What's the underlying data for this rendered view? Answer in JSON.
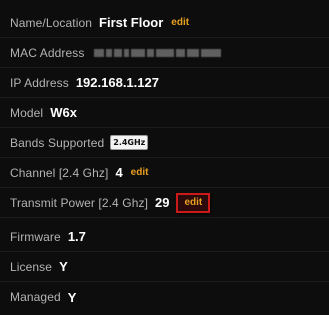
{
  "rows": {
    "name": {
      "label": "Name/Location",
      "value": "First Floor",
      "edit": "edit"
    },
    "mac": {
      "label": "MAC Address",
      "value": ""
    },
    "ip": {
      "label": "IP Address",
      "value": "192.168.1.127"
    },
    "model": {
      "label": "Model",
      "value": "W6x"
    },
    "bands": {
      "label": "Bands Supported",
      "badge": "2.4GHz"
    },
    "channel": {
      "label": "Channel [2.4 Ghz]",
      "value": "4",
      "edit": "edit"
    },
    "power": {
      "label": "Transmit Power [2.4 Ghz]",
      "value": "29",
      "edit": "edit"
    },
    "firmware": {
      "label": "Firmware",
      "value": "1.7"
    },
    "license": {
      "label": "License",
      "value": "Y"
    },
    "managed": {
      "label": "Managed",
      "value": "Y"
    }
  },
  "colors": {
    "background": "#0d0d0d",
    "label": "#b3b3b3",
    "value": "#ffffff",
    "edit_link": "#e8a020",
    "highlight_border": "#cc1a1a"
  }
}
